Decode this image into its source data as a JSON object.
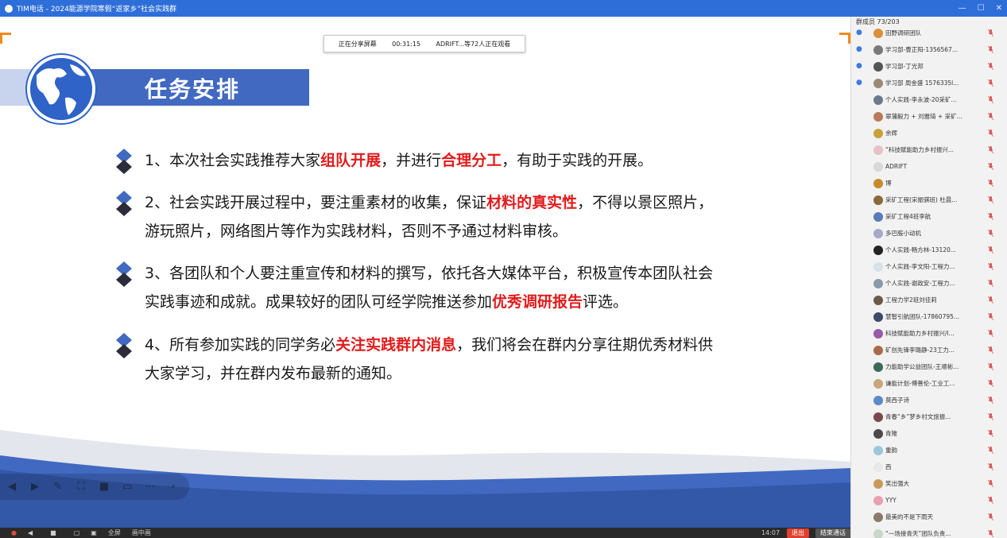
{
  "window": {
    "title": "TIM电话 - 2024能源学院寒假“返家乡”社会实践群"
  },
  "share_banner": {
    "status": "正在分享屏幕",
    "time": "00:31:15",
    "viewers": "ADRIFT...等72人正在观看"
  },
  "slide": {
    "title": "任务安排",
    "items": [
      {
        "parts": [
          "1、本次社会实践推荐大家",
          "组队开展",
          "，并进行",
          "合理分工",
          "，有助于实践的开展。"
        ]
      },
      {
        "parts": [
          "2、社会实践开展过程中，要注重素材的收集，保证",
          "材料的真实性",
          "，不得以景区照片，游玩照片，网络图片等作为实践材料，否则不予通过材料审核。",
          "",
          ""
        ]
      },
      {
        "parts": [
          "3、各团队和个人要注重宣传和材料的撰写，依托各大媒体平台，积极宣传本团队社会实践事迹和成就。成果较好的团队可经学院推送参加",
          "优秀调研报告",
          "评选。",
          "",
          ""
        ]
      },
      {
        "parts": [
          "4、所有参加实践的同学务必",
          "关注实践群内消息",
          "，我们将会在群内分享往期优秀材料供大家学习，并在群内发布最新的通知。",
          "",
          ""
        ]
      }
    ]
  },
  "bottombar": {
    "full": "全屏",
    "pip": "画中画",
    "time": "14:07",
    "exit": "退出",
    "end_call": "结束通话"
  },
  "members_panel": {
    "header": "群成员 73/203",
    "members": [
      {
        "name": "田野调研团队",
        "admin": true,
        "color": "#d9903a"
      },
      {
        "name": "学习部-曹正阳-1356567...",
        "admin": true,
        "color": "#7a7a7a"
      },
      {
        "name": "学习部-丁光邦",
        "admin": true,
        "color": "#555555"
      },
      {
        "name": "学习部 周金盛 1576335l...",
        "admin": true,
        "color": "#9a8a78"
      },
      {
        "name": "个人实践-李永波-20采矿...",
        "admin": false,
        "color": "#6a7a8a"
      },
      {
        "name": "翠蒲毅力 + 刘雅琦 + 采矿...",
        "admin": false,
        "color": "#b87a5a"
      },
      {
        "name": "余辉",
        "admin": false,
        "color": "#c7a23a"
      },
      {
        "name": "“科技赋能助力乡村振兴...",
        "admin": false,
        "color": "#e7c0c8"
      },
      {
        "name": "ADRIFT",
        "admin": false,
        "color": "#d8d8d8"
      },
      {
        "name": "博",
        "admin": false,
        "color": "#c88a2a"
      },
      {
        "name": "采矿工程(宋振骐班) 杜晨...",
        "admin": false,
        "color": "#8a6a3a"
      },
      {
        "name": "采矿工程4班李航",
        "admin": false,
        "color": "#5a7ab8"
      },
      {
        "name": "多巴胺小动机",
        "admin": false,
        "color": "#a8a8c8"
      },
      {
        "name": "个人实践-畅方林-13120...",
        "admin": false,
        "color": "#222222"
      },
      {
        "name": "个人实践-李文阳-工程力...",
        "admin": false,
        "color": "#d8e0e8"
      },
      {
        "name": "个人实践-谢政安-工程力...",
        "admin": false,
        "color": "#8a9aaa"
      },
      {
        "name": "工程力学2班刘佳莉",
        "admin": false,
        "color": "#6a5a4a"
      },
      {
        "name": "慧智引航团队-17860795...",
        "admin": false,
        "color": "#3a4a6a"
      },
      {
        "name": "科技赋能助力乡村振兴/l...",
        "admin": false,
        "color": "#9a5aa8"
      },
      {
        "name": "矿创先锋李璐静-23工力...",
        "admin": false,
        "color": "#a86a4a"
      },
      {
        "name": "力能助学公益团队-王顺彬...",
        "admin": false,
        "color": "#3a6a5a"
      },
      {
        "name": "谦能计划-傅善伦-工业工...",
        "admin": false,
        "color": "#c8a878"
      },
      {
        "name": "莫西子诗",
        "admin": false,
        "color": "#5a8ac8"
      },
      {
        "name": "青春“乡”梦乡村文旅振...",
        "admin": false,
        "color": "#7a4a4a"
      },
      {
        "name": "青雉",
        "admin": false,
        "color": "#4a4a4a"
      },
      {
        "name": "重韵",
        "admin": false,
        "color": "#9ac8d8"
      },
      {
        "name": "西",
        "admin": false,
        "color": "#e8e8e8"
      },
      {
        "name": "笑出强大",
        "admin": false,
        "color": "#c89a5a"
      },
      {
        "name": "YYY",
        "admin": false,
        "color": "#e8a0b0"
      },
      {
        "name": "最美的不是下雨天",
        "admin": false,
        "color": "#8a7a6a"
      },
      {
        "name": "“一场接青天”团队负责...",
        "admin": false,
        "color": "#c8d8c8"
      }
    ]
  },
  "colors": {
    "title_bar": "#2e6ed9",
    "highlight": "#e11b1b",
    "band": "#4169c1",
    "orange_bracket": "#f28a1b"
  }
}
